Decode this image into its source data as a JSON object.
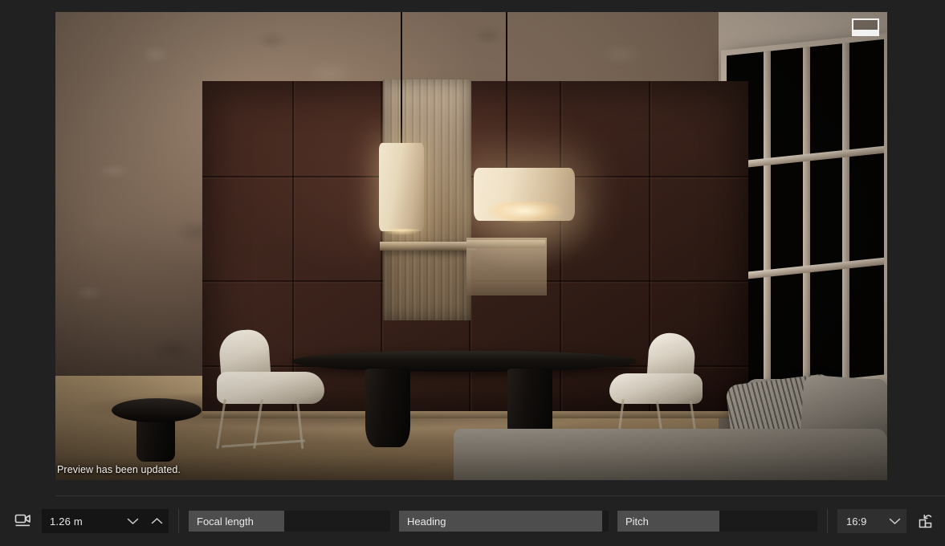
{
  "preview": {
    "status_message": "Preview has been updated.",
    "overlay_button_name": "toggle-preview-panel"
  },
  "scene": {
    "description": "Rendered night-time interior of a dining room with dark wood panelled wall, two pendant lights, oval dining table, two white chairs, side stool, large multi-pane window and a grey sofa with cushions",
    "lights": [
      "tall-cylinder-pendant",
      "wide-drum-pendant"
    ]
  },
  "toolbar": {
    "camera_icon_name": "camera-icon",
    "distance": {
      "value": "1.26 m",
      "decrease_label": "⌄",
      "increase_label": "⌃"
    },
    "fields": [
      {
        "label": "Focal length",
        "value": ""
      },
      {
        "label": "Heading",
        "value": ""
      },
      {
        "label": "Pitch",
        "value": ""
      }
    ],
    "aspect_ratio": {
      "value": "16:9",
      "options": [
        "16:9"
      ]
    },
    "orientation_button_name": "swap-orientation-button"
  },
  "colors": {
    "app_background": "#212121",
    "field_label_bg": "#4d4d4d",
    "field_input_bg": "#1a1a1a",
    "stepper_bg": "#151515",
    "select_bg": "#2f2f2f",
    "text": "#e6e6e6",
    "divider": "#3b3b3b"
  }
}
